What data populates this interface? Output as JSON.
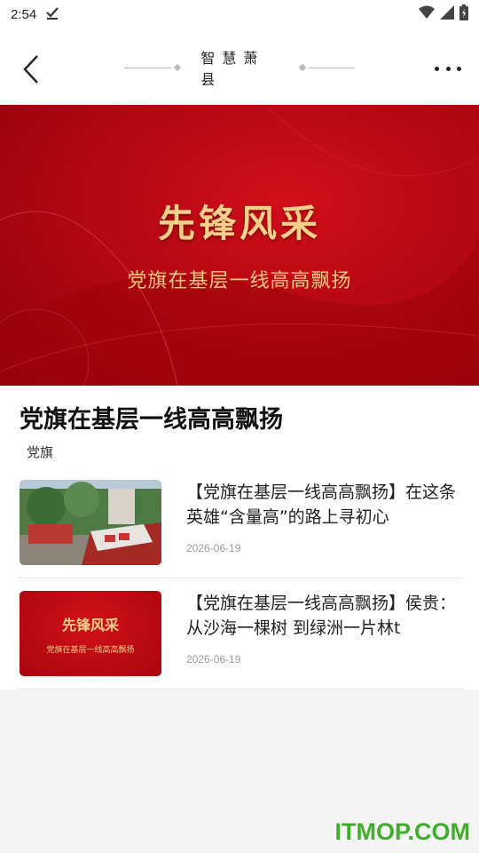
{
  "status": {
    "time": "2:54"
  },
  "nav": {
    "title": "智慧萧县"
  },
  "banner": {
    "title": "先锋风采",
    "subtitle": "党旗在基层一线高高飘扬"
  },
  "section": {
    "title": "党旗在基层一线高高飘扬",
    "tag": "党旗"
  },
  "articles": [
    {
      "title": "【党旗在基层一线高高飘扬】在这条英雄“含量高”的路上寻初心",
      "date": "2026-06-19"
    },
    {
      "title": "【党旗在基层一线高高飘扬】侯贵：从沙海一棵树 到绿洲一片林t",
      "date": "2026-06-19",
      "thumb_title": "先锋风采",
      "thumb_sub": "党旗在基层一线高高飘扬"
    }
  ],
  "watermark": "ITMOP.COM",
  "colors": {
    "banner_red": "#b50812",
    "gold": "#f4d08a",
    "watermark": "#3fae2a"
  }
}
